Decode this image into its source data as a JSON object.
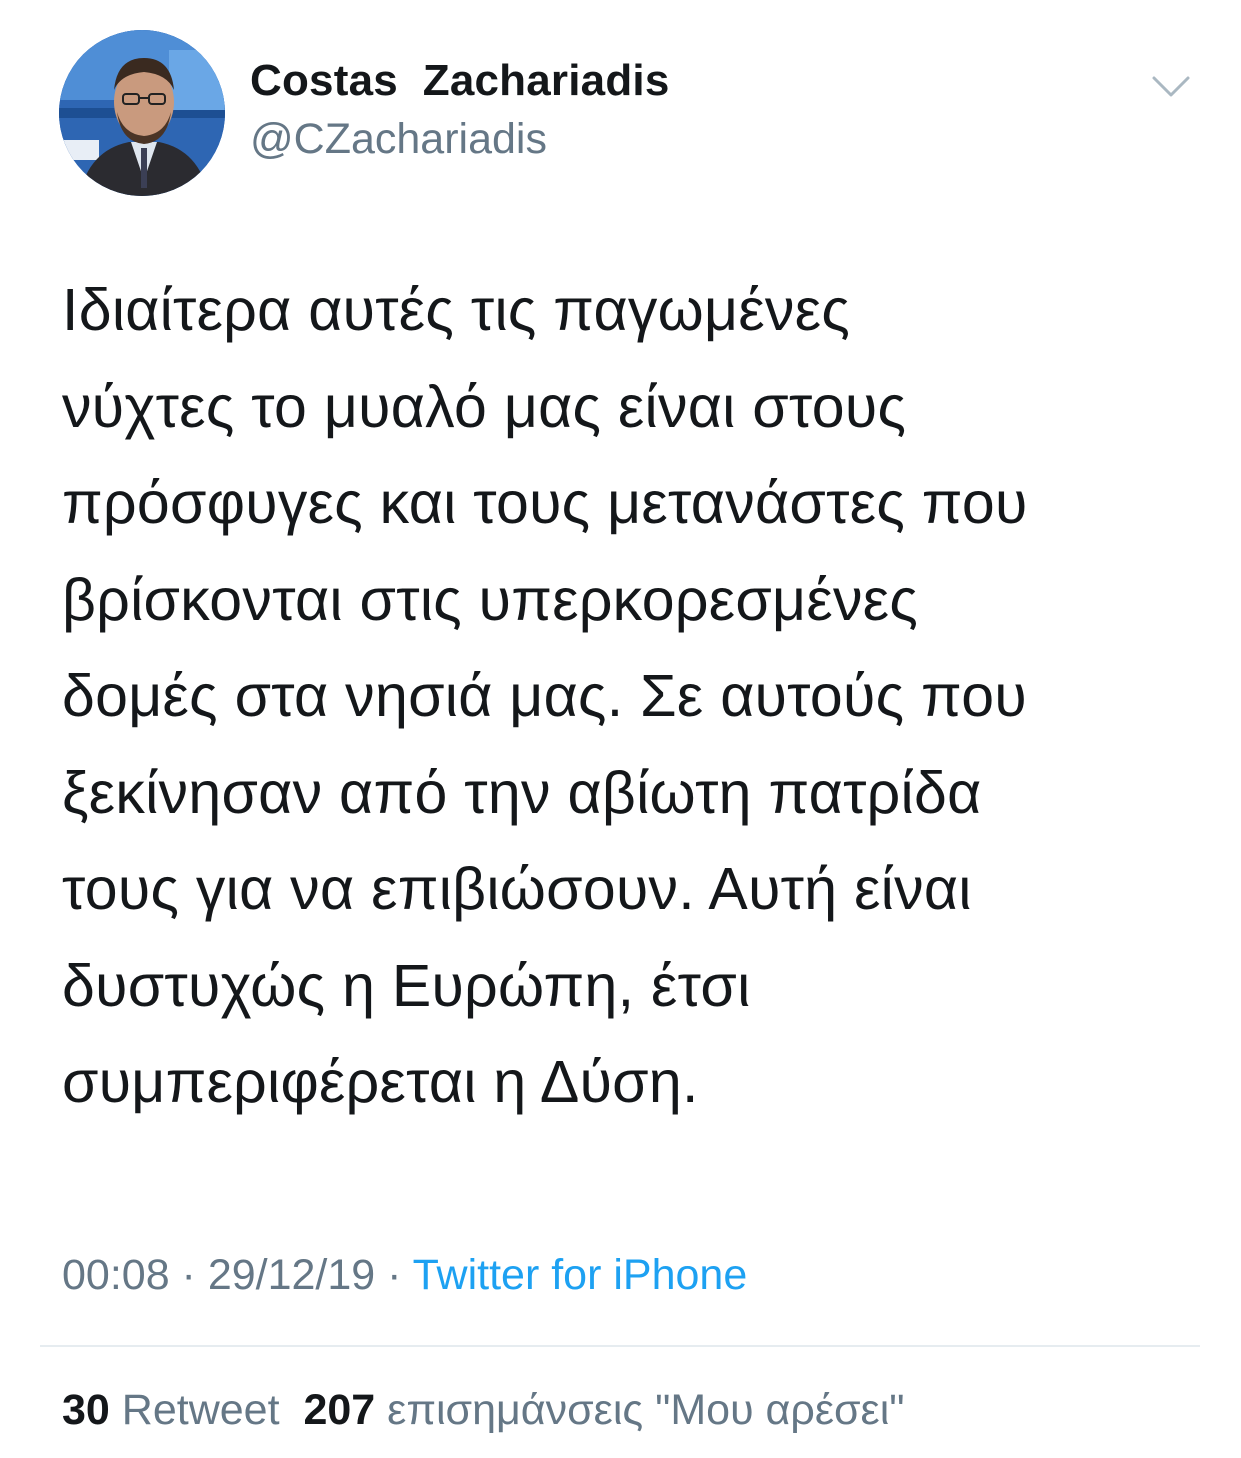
{
  "author": {
    "display_name": "Costas  Zachariadis",
    "handle": "@CZachariadis",
    "avatar": "profile-photo"
  },
  "menu_icon": "chevron-down-icon",
  "tweet": {
    "lines": [
      "Ιδιαίτερα αυτές τις παγωμένες",
      "νύχτες το μυαλό μας είναι στους",
      "πρόσφυγες και τους μετανάστες που",
      "βρίσκονται στις υπερκορεσμένες",
      "δομές στα νησιά μας. Σε αυτούς που",
      "ξεκίνησαν από την αβίωτη πατρίδα",
      "τους για να επιβιώσουν. Αυτή είναι",
      "δυστυχώς η Ευρώπη, έτσι",
      "συμπεριφέρεται η Δύση."
    ]
  },
  "meta": {
    "time": "00:08",
    "separator": " · ",
    "date": "29/12/19",
    "source": "Twitter for iPhone"
  },
  "stats": {
    "retweets_count": "30",
    "retweets_label": "Retweet",
    "likes_count": "207",
    "likes_label": "επισημάνσεις \"Μου αρέσει\""
  },
  "colors": {
    "text": "#14171a",
    "secondary": "#657786",
    "link": "#1da1f2",
    "divider": "#e6ecf0"
  }
}
